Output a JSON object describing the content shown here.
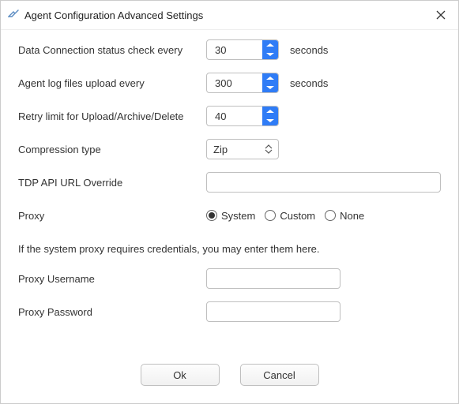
{
  "window": {
    "title": "Agent Configuration Advanced Settings"
  },
  "fields": {
    "data_conn_label": "Data Connection status check every",
    "data_conn_value": "30",
    "data_conn_unit": "seconds",
    "log_upload_label": "Agent log files upload every",
    "log_upload_value": "300",
    "log_upload_unit": "seconds",
    "retry_label": "Retry limit for Upload/Archive/Delete",
    "retry_value": "40",
    "compression_label": "Compression type",
    "compression_value": "Zip",
    "tdp_label": "TDP API URL Override",
    "tdp_value": "",
    "proxy_label": "Proxy",
    "proxy_options": {
      "system": "System",
      "custom": "Custom",
      "none": "None",
      "selected": "system"
    },
    "proxy_note": "If the system proxy requires credentials, you may enter them here.",
    "proxy_user_label": "Proxy Username",
    "proxy_user_value": "",
    "proxy_pass_label": "Proxy Password",
    "proxy_pass_value": ""
  },
  "buttons": {
    "ok": "Ok",
    "cancel": "Cancel"
  }
}
